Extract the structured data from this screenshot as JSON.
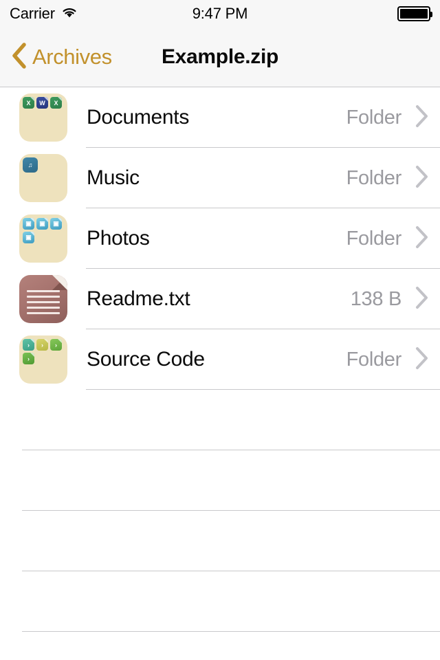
{
  "status_bar": {
    "carrier": "Carrier",
    "wifi_icon": "wifi-icon",
    "time": "9:47 PM",
    "battery_icon": "battery-full-icon"
  },
  "nav_bar": {
    "back_icon": "chevron-left-icon",
    "back_label": "Archives",
    "title": "Example.zip",
    "tint_color": "#c2912c"
  },
  "file_list": {
    "disclosure_icon": "chevron-right-icon",
    "rows": [
      {
        "name": "Documents",
        "detail": "Folder",
        "icon": "folder-icon",
        "badges": [
          {
            "kind": "badge-x",
            "glyph": "X"
          },
          {
            "kind": "badge-w",
            "glyph": "W"
          },
          {
            "kind": "badge-x",
            "glyph": "X"
          }
        ]
      },
      {
        "name": "Music",
        "detail": "Folder",
        "icon": "folder-icon",
        "badges": [
          {
            "kind": "badge-music",
            "glyph": "♫"
          }
        ]
      },
      {
        "name": "Photos",
        "detail": "Folder",
        "icon": "folder-icon",
        "badges": [
          {
            "kind": "badge-img",
            "glyph": "▣"
          },
          {
            "kind": "badge-img",
            "glyph": "▣"
          },
          {
            "kind": "badge-img",
            "glyph": "▣"
          },
          {
            "kind": "badge-img",
            "glyph": "▣"
          }
        ]
      },
      {
        "name": "Readme.txt",
        "detail": "138 B",
        "icon": "text-document-icon",
        "badges": []
      },
      {
        "name": "Source Code",
        "detail": "Folder",
        "icon": "folder-icon",
        "badges": [
          {
            "kind": "badge-code-1",
            "glyph": "›"
          },
          {
            "kind": "badge-code-2",
            "glyph": "›"
          },
          {
            "kind": "badge-code-3",
            "glyph": "›"
          },
          {
            "kind": "badge-code-4",
            "glyph": "›"
          }
        ]
      }
    ],
    "empty_row_count": 4
  }
}
